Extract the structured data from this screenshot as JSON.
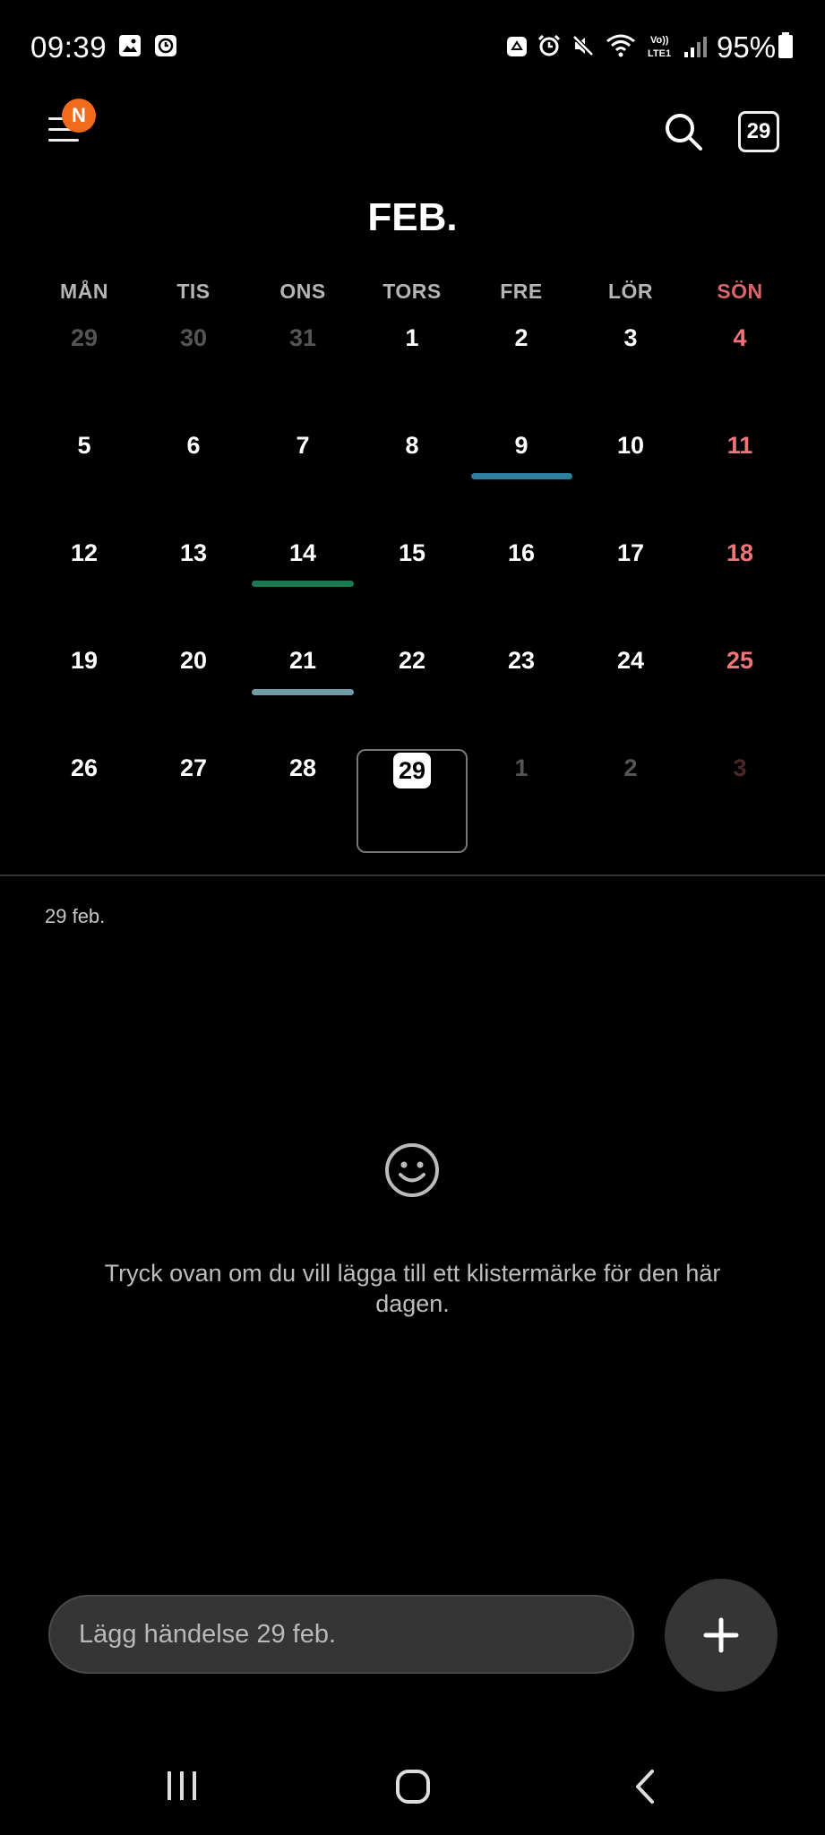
{
  "status_bar": {
    "time": "09:39",
    "battery": "95%",
    "icons": [
      "image-notification-icon",
      "clock-app-icon",
      "recycle-icon",
      "alarm-icon",
      "mute-icon",
      "wifi-icon",
      "volte-lte-icon",
      "signal-icon",
      "battery-icon"
    ]
  },
  "toolbar": {
    "menu_badge": "N",
    "today_label": "29"
  },
  "calendar": {
    "month_title": "FEB.",
    "weekdays": [
      "MÅN",
      "TIS",
      "ONS",
      "TORS",
      "FRE",
      "LÖR",
      "SÖN"
    ],
    "weeks": [
      [
        "29",
        "30",
        "31",
        "1",
        "2",
        "3",
        "4"
      ],
      [
        "5",
        "6",
        "7",
        "8",
        "9",
        "10",
        "11"
      ],
      [
        "12",
        "13",
        "14",
        "15",
        "16",
        "17",
        "18"
      ],
      [
        "19",
        "20",
        "21",
        "22",
        "23",
        "24",
        "25"
      ],
      [
        "26",
        "27",
        "28",
        "29",
        "1",
        "2",
        "3"
      ]
    ],
    "event_colors": {
      "9": "#2e7f9e",
      "14": "#1b7a52",
      "21": "#6f9ea6"
    },
    "today": "29"
  },
  "detail": {
    "selected_date": "29 feb.",
    "hint": "Tryck ovan om du vill lägga till ett klistermärke för den här dagen."
  },
  "quick_add": {
    "placeholder": "Lägg händelse 29 feb."
  }
}
